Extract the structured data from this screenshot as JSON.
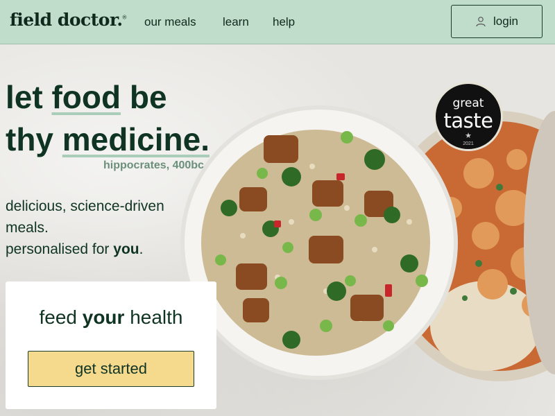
{
  "header": {
    "logo": "field doctor.",
    "logo_mark": "®",
    "nav": [
      {
        "label": "our meals"
      },
      {
        "label": "learn"
      },
      {
        "label": "help"
      }
    ],
    "login_label": "login",
    "login_icon": "user-icon"
  },
  "hero": {
    "headline_line1_a": "let ",
    "headline_line1_b": "food",
    "headline_line1_c": " be",
    "headline_line2_a": "thy ",
    "headline_line2_b": "medicine.",
    "attribution": "hippocrates, 400bc",
    "sub_line1": "delicious, science-driven",
    "sub_line2": "meals.",
    "sub_line3_a": "personalised for ",
    "sub_line3_b": "you",
    "sub_line3_c": "."
  },
  "cta": {
    "title_a": "feed ",
    "title_b": "your",
    "title_c": " health",
    "button_label": "get started"
  },
  "badge": {
    "line1": "great",
    "line2": "taste",
    "star": "★",
    "year": "2021",
    "mark": "®"
  },
  "colors": {
    "header_bg": "#c0dccb",
    "brand_dark": "#103424",
    "accent_underline": "#a9cdb8",
    "cta_yellow": "#f5d98c"
  }
}
